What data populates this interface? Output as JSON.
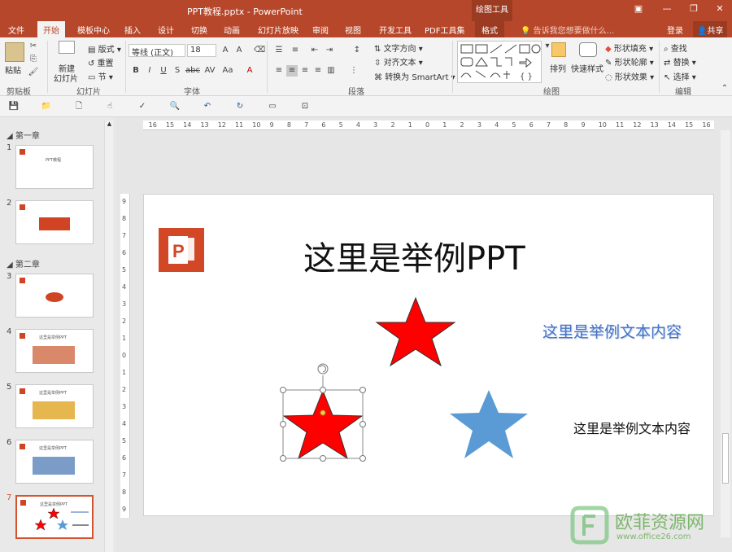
{
  "titlebar": {
    "title": "PPT教程.pptx - PowerPoint",
    "context_tab": "绘图工具",
    "min_icon": "minimize-icon",
    "restore_icon": "restore-icon",
    "close_icon": "close-icon"
  },
  "tabs": [
    {
      "label": "文件"
    },
    {
      "label": "开始"
    },
    {
      "label": "模板中心"
    },
    {
      "label": "插入"
    },
    {
      "label": "设计"
    },
    {
      "label": "切换"
    },
    {
      "label": "动画"
    },
    {
      "label": "幻灯片放映"
    },
    {
      "label": "审阅"
    },
    {
      "label": "视图"
    },
    {
      "label": "开发工具"
    },
    {
      "label": "PDF工具集"
    },
    {
      "label": "格式"
    }
  ],
  "tell_me": "告诉我您想要做什么...",
  "account": {
    "login": "登录",
    "share": "共享"
  },
  "ribbon": {
    "clipboard": {
      "paste": "粘贴",
      "group": "剪贴板"
    },
    "slides": {
      "new_slide_1": "新建",
      "new_slide_2": "幻灯片",
      "layout": "版式",
      "reset": "重置",
      "section": "节",
      "group": "幻灯片"
    },
    "font": {
      "name": "等线 (正文)",
      "size": "18",
      "group": "字体"
    },
    "paragraph": {
      "text_direction": "文字方向",
      "align_text": "对齐文本",
      "convert": "转换为 SmartArt",
      "group": "段落"
    },
    "drawing": {
      "arrange": "排列",
      "quick_styles": "快速样式",
      "fill": "形状填充",
      "outline": "形状轮廓",
      "effects": "形状效果",
      "group": "绘图"
    },
    "editing": {
      "find": "查找",
      "replace": "替换",
      "select": "选择",
      "group": "编辑"
    }
  },
  "thumbnails": {
    "sections": [
      "第一章",
      "第二章"
    ],
    "slides": [
      {
        "num": "1",
        "caption": "PPT教程"
      },
      {
        "num": "2"
      },
      {
        "num": "3"
      },
      {
        "num": "4",
        "caption": "这里是举例PPT"
      },
      {
        "num": "5",
        "caption": "这里是举例PPT"
      },
      {
        "num": "6",
        "caption": "这里是举例PPT"
      },
      {
        "num": "7",
        "caption": "这里是举例PPT"
      }
    ],
    "selected": "7"
  },
  "ruler_labels": [
    "16",
    "15",
    "14",
    "13",
    "12",
    "11",
    "10",
    "9",
    "8",
    "7",
    "6",
    "5",
    "4",
    "3",
    "2",
    "1",
    "0",
    "1",
    "2",
    "3",
    "4",
    "5",
    "6",
    "7",
    "8",
    "9",
    "10",
    "11",
    "12",
    "13",
    "14",
    "15",
    "16"
  ],
  "vruler_labels": [
    "9",
    "8",
    "7",
    "6",
    "5",
    "4",
    "3",
    "2",
    "1",
    "0",
    "1",
    "2",
    "3",
    "4",
    "5",
    "6",
    "7",
    "8",
    "9"
  ],
  "slide": {
    "title": "这里是举例PPT",
    "text_1": "这里是举例文本内容",
    "text_2": "这里是举例文本内容",
    "colors": {
      "red_star": "#ff0000",
      "blue_star": "#5b9bd5",
      "text_blue": "#4472c4",
      "logo": "#d24726"
    }
  },
  "watermark": {
    "brand": "欧菲资源网",
    "url": "www.office26.com"
  }
}
